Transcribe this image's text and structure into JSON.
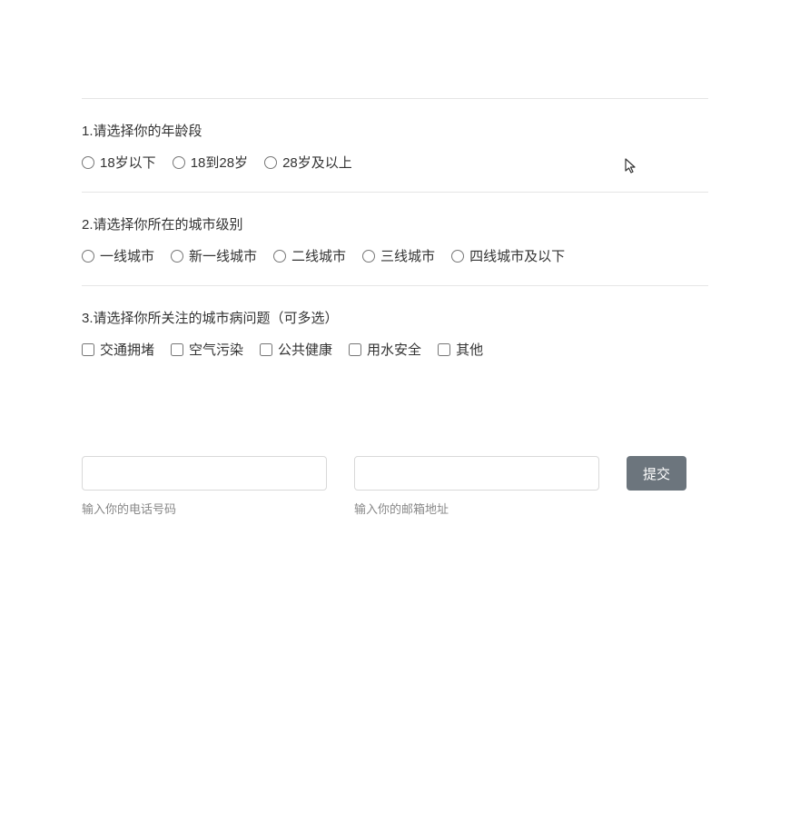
{
  "questions": {
    "q1": {
      "label": "1.请选择你的年龄段",
      "options": [
        "18岁以下",
        "18到28岁",
        "28岁及以上"
      ]
    },
    "q2": {
      "label": "2.请选择你所在的城市级别",
      "options": [
        "一线城市",
        "新一线城市",
        "二线城市",
        "三线城市",
        "四线城市及以下"
      ]
    },
    "q3": {
      "label": "3.请选择你所关注的城市病问题（可多选）",
      "options": [
        "交通拥堵",
        "空气污染",
        "公共健康",
        "用水安全",
        "其他"
      ]
    }
  },
  "inputs": {
    "phone": {
      "helper": "输入你的电话号码"
    },
    "email": {
      "helper": "输入你的邮箱地址"
    }
  },
  "submit_label": "提交"
}
